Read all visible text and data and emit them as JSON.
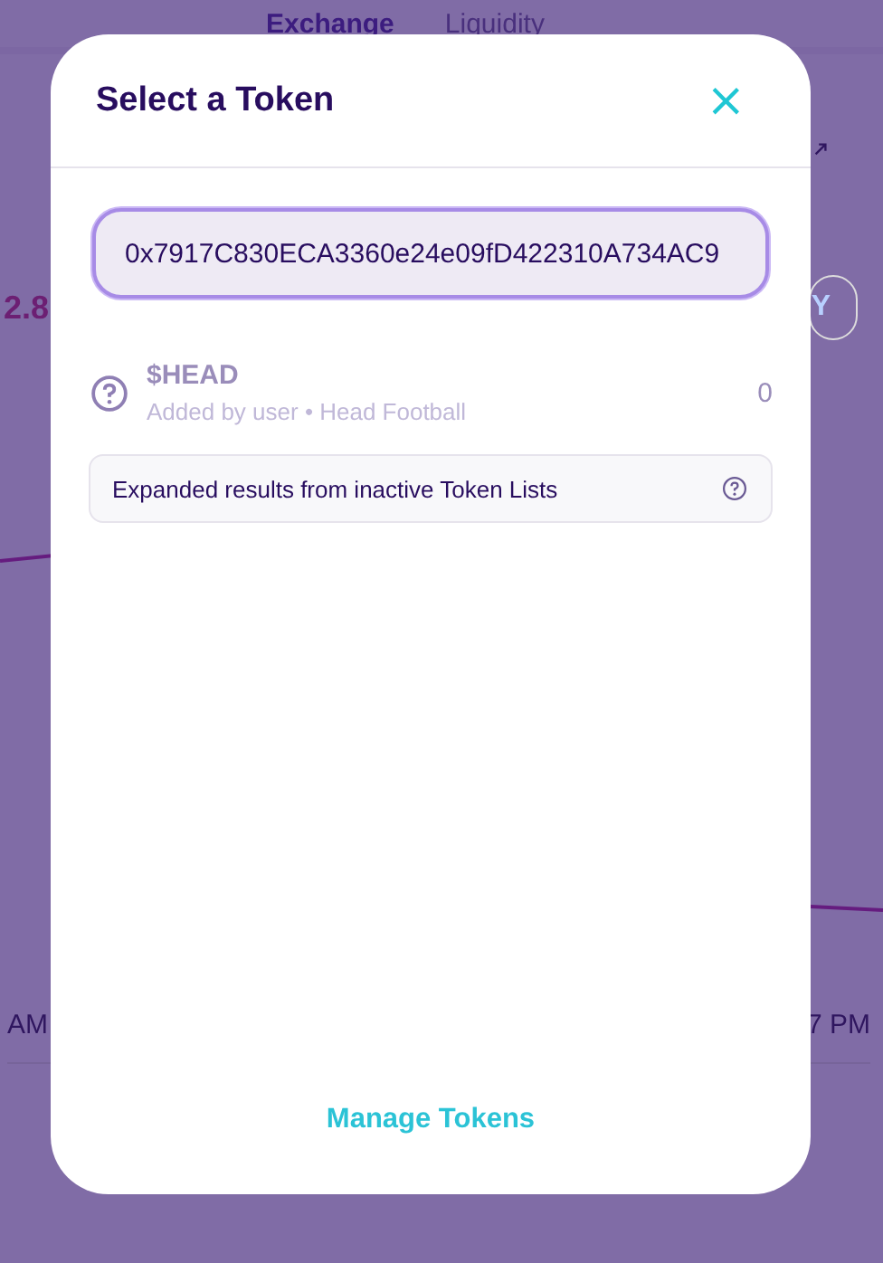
{
  "background": {
    "tabs": [
      {
        "label": "Exchange",
        "selected": true
      },
      {
        "label": "Liquidity",
        "selected": false
      }
    ],
    "price_fragment": "2.8",
    "button_fragment": "Y",
    "time_labels": [
      "AM",
      "7 PM"
    ]
  },
  "modal": {
    "title": "Select a Token",
    "close": "×",
    "search": {
      "value": "0x7917C830ECA3360e24e09fD422310A734AC9"
    },
    "tokens": [
      {
        "symbol": "$HEAD",
        "subtitle": "Added by user • Head Football",
        "balance": "0"
      }
    ],
    "notice": "Expanded results from inactive Token Lists",
    "manage_button": "Manage Tokens"
  }
}
